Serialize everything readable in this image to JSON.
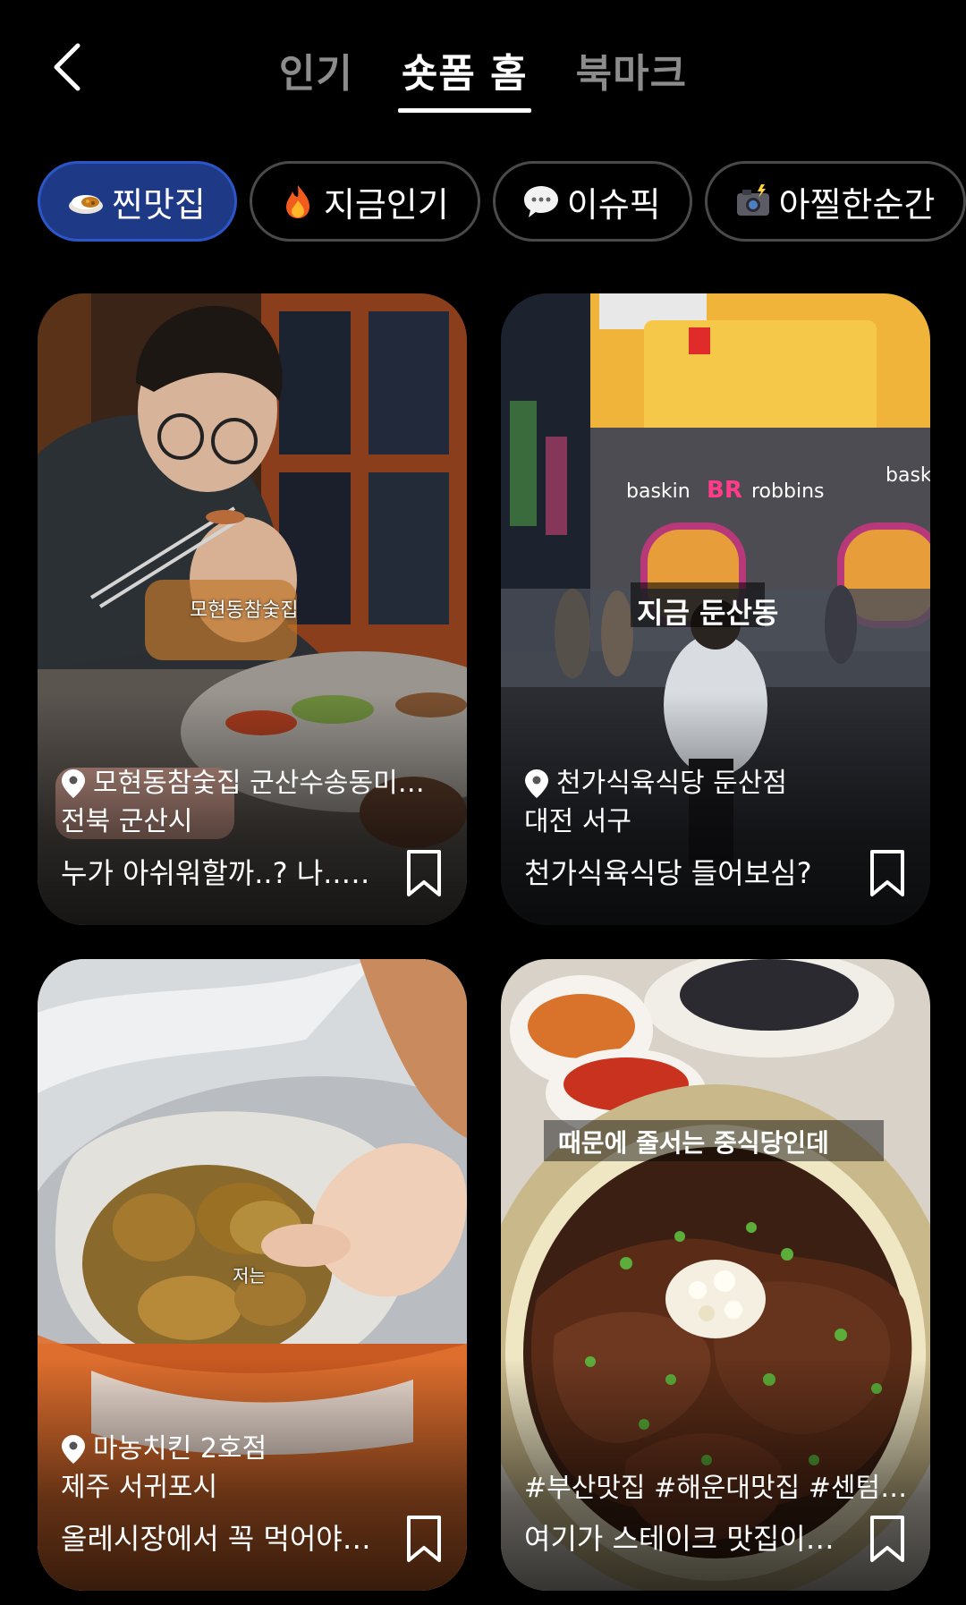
{
  "header": {
    "back_icon": "chevron-left-icon",
    "tabs": [
      {
        "label": "인기",
        "active": false
      },
      {
        "label": "숏폼 홈",
        "active": true
      },
      {
        "label": "북마크",
        "active": false
      }
    ]
  },
  "chips": [
    {
      "icon": "curry-rice-icon",
      "label": "찐맛집",
      "active": true
    },
    {
      "icon": "fire-icon",
      "label": "지금인기",
      "active": false
    },
    {
      "icon": "speech-bubble-icon",
      "label": "이슈픽",
      "active": false
    },
    {
      "icon": "camera-flash-icon",
      "label": "아찔한순간",
      "active": false
    }
  ],
  "cards": [
    {
      "overlay": "모현동참숯집",
      "place": "모현동참숯집 군산수송동미…",
      "region": "전북 군산시",
      "title": "누가 아쉬워할까..? 나..…",
      "bookmark_icon": "bookmark-icon"
    },
    {
      "overlay": "지금 둔산동",
      "place": "천가식육식당 둔산점",
      "region": "대전 서구",
      "title": "천가식육식당 들어보심?",
      "bookmark_icon": "bookmark-icon"
    },
    {
      "overlay": "저는",
      "place": "마농치킨 2호점",
      "region": "제주 서귀포시",
      "title": "올레시장에서 꼭 먹어야…",
      "bookmark_icon": "bookmark-icon"
    },
    {
      "overlay": "때문에 줄서는 중식당인데",
      "hashtags": "#부산맛집 #해운대맛집 #센텀…",
      "title": "여기가 스테이크 맛집이…",
      "bookmark_icon": "bookmark-icon"
    }
  ],
  "colors": {
    "background": "#000000",
    "chip_active_bg": "#1e3a86",
    "chip_active_border": "#2c56c7",
    "chip_border": "#4a4a4a",
    "tab_inactive": "#8c8c8c"
  }
}
